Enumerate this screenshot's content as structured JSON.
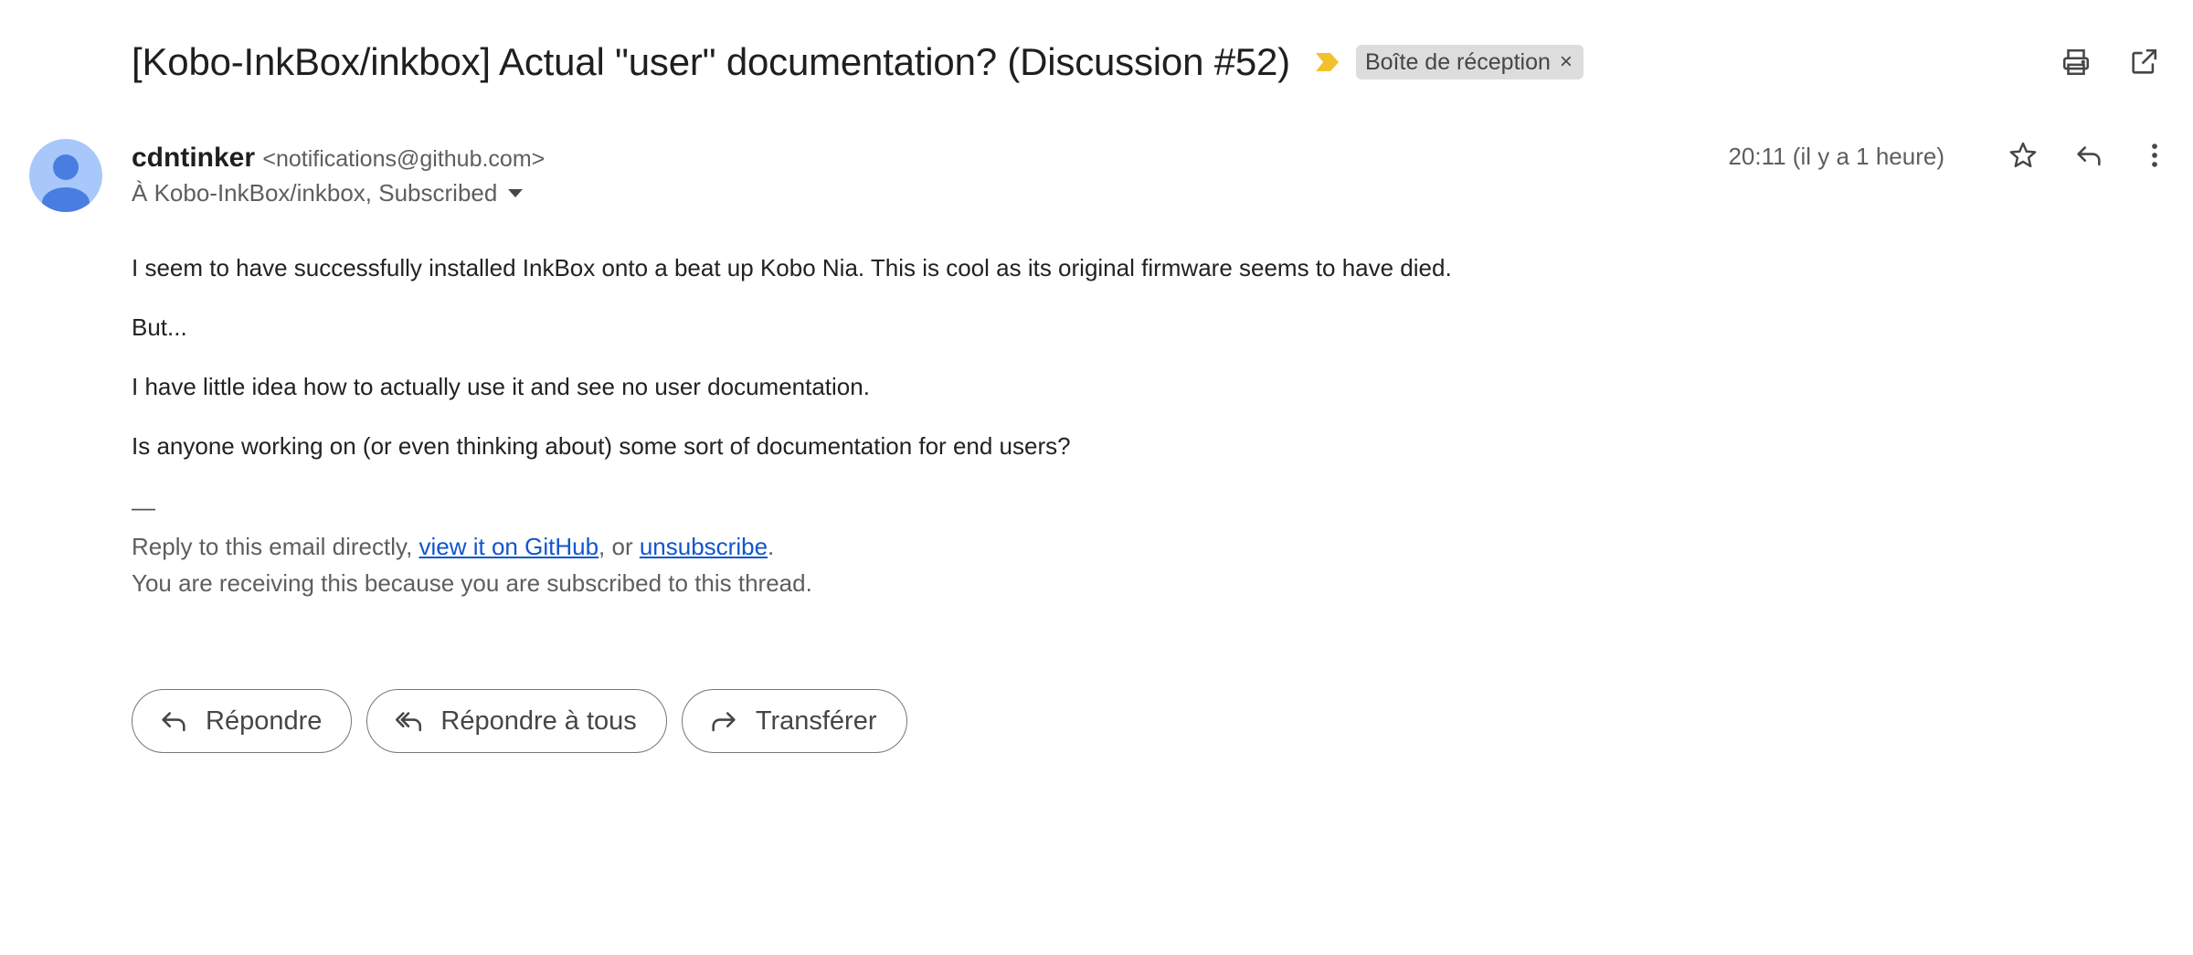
{
  "email": {
    "subject": "[Kobo-InkBox/inkbox] Actual \"user\" documentation? (Discussion #52)",
    "label": "Boîte de réception",
    "label_remove": "×",
    "sender_name": "cdntinker",
    "sender_email": "<notifications@github.com>",
    "recipients": "À Kobo-InkBox/inkbox, Subscribed",
    "timestamp": "20:11 (il y a 1 heure)",
    "body": [
      "I seem to have successfully installed InkBox onto a beat up Kobo Nia. This is cool as its original firmware seems to have died.",
      "But...",
      "I have little idea how to actually use it and see no user documentation.",
      "Is anyone working on (or even thinking about) some sort of documentation for end users?"
    ],
    "signature_dash": "—",
    "footer": {
      "line1_prefix": "Reply to this email directly, ",
      "link_github": "view it on GitHub",
      "line1_middle": ", or ",
      "link_unsubscribe": "unsubscribe",
      "line1_suffix": ".",
      "line2": "You are receiving this because you are subscribed to this thread."
    }
  },
  "actions": {
    "reply": "Répondre",
    "reply_all": "Répondre à tous",
    "forward": "Transférer"
  },
  "icons": {
    "importance": "importance-marker-icon",
    "print": "print-icon",
    "open_new_window": "open-in-new-window-icon",
    "star": "star-icon",
    "reply": "reply-icon",
    "more": "more-vert-icon"
  },
  "colors": {
    "importance_marker": "#f2c12e",
    "link": "#1155cc",
    "avatar_bg": "#a8c7fa",
    "avatar_fg": "#4a7de0",
    "label_chip_bg": "#dddddd"
  }
}
